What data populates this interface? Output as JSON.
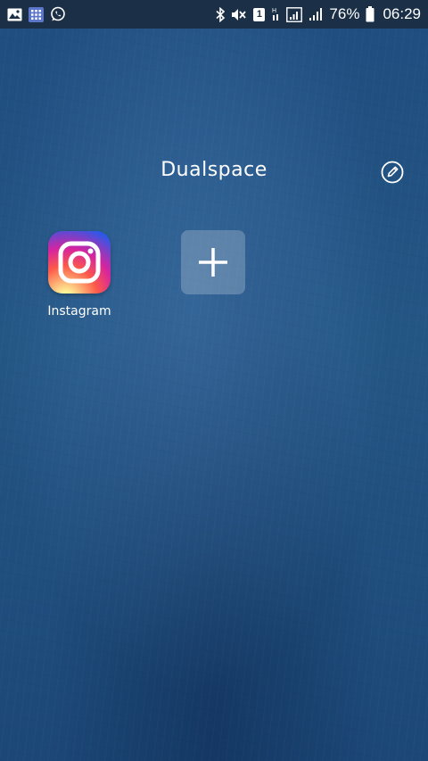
{
  "status_bar": {
    "left_icons": [
      "gallery-icon",
      "app-grid-icon",
      "whatsapp-icon"
    ],
    "right_icons": [
      "bluetooth-icon",
      "mute-icon",
      "sim-icon",
      "data-icon",
      "signal-icon",
      "wifi-signal-icon",
      "battery-icon"
    ],
    "sim_label": "1",
    "battery_percent": "76%",
    "time": "06:29"
  },
  "header": {
    "title": "Dualspace",
    "edit_icon": "edit-pencil-icon"
  },
  "apps": [
    {
      "label": "Instagram",
      "icon": "instagram-icon"
    }
  ],
  "add_app": {
    "icon": "plus-icon"
  },
  "colors": {
    "status_bar_bg": "#1b3047",
    "background": "#245684",
    "text": "#ffffff"
  }
}
